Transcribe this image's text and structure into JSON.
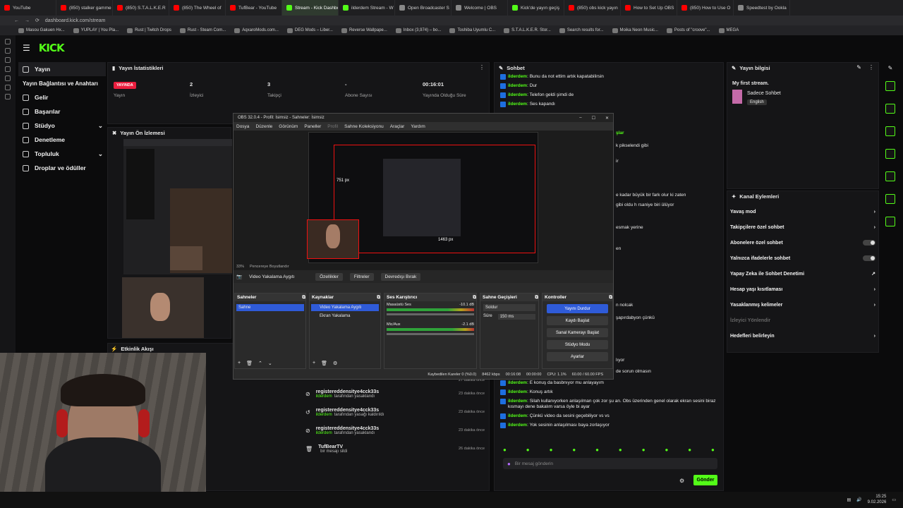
{
  "browser": {
    "tabs": [
      {
        "label": "YouTube",
        "color": "#ff0000",
        "active": false
      },
      {
        "label": "(850) stalker gamme",
        "color": "#ff0000",
        "active": false
      },
      {
        "label": "(850) S.T.A.L.K.E.R",
        "color": "#ff0000",
        "active": false
      },
      {
        "label": "(850) The Wheel of",
        "color": "#ff0000",
        "active": false
      },
      {
        "label": "TufBear - YouTube",
        "color": "#ff0000",
        "active": false
      },
      {
        "label": "Stream - Kick Dashbo",
        "color": "#53fc18",
        "active": true
      },
      {
        "label": "ilderdem Stream - W",
        "color": "#53fc18",
        "active": false
      },
      {
        "label": "Open Broadcaster S",
        "color": "#888888",
        "active": false
      },
      {
        "label": "Welcome | OBS",
        "color": "#888888",
        "active": false
      },
      {
        "label": "Kick'de yayın geçiş",
        "color": "#53fc18",
        "active": false
      },
      {
        "label": "(850) obs kick yayın",
        "color": "#ff0000",
        "active": false
      },
      {
        "label": "How to Set Up OBS",
        "color": "#ff0000",
        "active": false
      },
      {
        "label": "(850) How to Use O",
        "color": "#ff0000",
        "active": false
      },
      {
        "label": "Speedtest by Ookla",
        "color": "#888888",
        "active": false
      }
    ],
    "url": "dashboard.kick.com/stream",
    "bookmarks": [
      "Masou Gakuen Hx...",
      "YUPLAY | You Pla...",
      "Rust | Twitch Drops",
      "Rust - Steam Com...",
      "AqxaroMods.com...",
      "DEG Mods – Liber...",
      "Reverse Wallpape...",
      "Inbox (3,974) – bo...",
      "Toshiba Uyumlu C...",
      "S.T.A.L.K.E.R. Stor...",
      "Search results for...",
      "Moika Neon Music...",
      "Posts of \"croove\"...",
      "MEGA"
    ]
  },
  "sidebar": {
    "logo": "KICK",
    "items": [
      {
        "label": "Yayın",
        "selected": true
      },
      {
        "label": "Yayın Bağlantısı ve Anahtarı",
        "selected": false
      },
      {
        "label": "Gelir",
        "selected": false
      },
      {
        "label": "Başarılar",
        "selected": false
      },
      {
        "label": "Stüdyo",
        "selected": false,
        "chevron": true
      },
      {
        "label": "Denetleme",
        "selected": false
      },
      {
        "label": "Topluluk",
        "selected": false,
        "chevron": true
      },
      {
        "label": "Droplar ve ödüller",
        "selected": false
      }
    ]
  },
  "stats": {
    "title": "Yayın İstatistikleri",
    "live_badge": "YAYINDA",
    "live_label": "Yayın",
    "viewers_value": "2",
    "viewers_label": "İzleyici",
    "followers_value": "3",
    "followers_label": "Takipçi",
    "subs_value": "-",
    "subs_label": "Abone Sayısı",
    "duration_value": "00:16:01",
    "duration_label": "Yayında Olduğu Süre"
  },
  "preview": {
    "title": "Yayın Ön İzlemesi"
  },
  "activity": {
    "title": "Etkinlik Akışı",
    "items": [
      {
        "time": "27 dakika önce",
        "user": "",
        "user_line": "",
        "detail": "",
        "icon": "",
        "partial": true
      },
      {
        "time": "23 dakika önce",
        "user": "registereddensitye4cck33s",
        "user_line": "ilderdem",
        "detail": "tarafından yasaklandı",
        "icon": "ban-icon"
      },
      {
        "time": "23 dakika önce",
        "user": "registereddensitye4cck33s",
        "user_line": "ilderdem",
        "detail": "tarafından yasağı kaldırıldı",
        "icon": "undo-icon"
      },
      {
        "time": "23 dakika önce",
        "user": "registereddensitye4cck33s",
        "user_line": "ilderdem",
        "detail": "tarafından yasaklandı",
        "icon": "ban-icon"
      },
      {
        "time": "26 dakika önce",
        "user": "TufBearTV",
        "user_line": "",
        "detail": "bir mesajı sildi",
        "icon": "trash-icon"
      }
    ]
  },
  "obs": {
    "title": "OBS 32.0.4 - Profil: İsimsiz - Sahneler: İsimsiz",
    "menu": [
      "Dosya",
      "Düzenle",
      "Görünüm",
      "Paneller",
      "Profil",
      "Sahne Koleksiyonu",
      "Araçlar",
      "Yardım"
    ],
    "zoom": "33%",
    "fit_label": "Pencereye Boyutlandır",
    "source_name": "Video Yakalama Aygıtı",
    "props_btn": "Özellikler",
    "filters_btn": "Filtreler",
    "deactivate_btn": "Devredışı Bırak",
    "scenes_title": "Sahneler",
    "scene_item": "Sahne",
    "sources_title": "Kaynaklar",
    "source_items": [
      "Video Yakalama Aygıtı",
      "Ekran Yakalama"
    ],
    "mixer_title": "Ses Karıştırıcı",
    "mixer_channels": [
      {
        "name": "Masaüstü Ses",
        "db": "-10.1 dB"
      },
      {
        "name": "Mic/Aux",
        "db": "-2.1 dB"
      }
    ],
    "transitions_title": "Sahne Geçişleri",
    "transition_value": "Soldur",
    "duration_label": "Süre",
    "duration_value": "150 ms",
    "controls_title": "Kontroller",
    "controls": [
      "Yayını Durdur",
      "Kaydı Başlat",
      "Sanal Kamerayı Başlat",
      "Stüdyo Modu",
      "Ayarlar"
    ],
    "status": {
      "dropped": "Kaybedilen Kareler 0 (%0.0)",
      "bitrate": "8462 kbps",
      "stream_time": "00:16:08",
      "rec_time": "00:00:00",
      "cpu": "CPU: 1.1%",
      "fps": "60.00 / 60.00 FPS"
    },
    "canvas_labels": [
      "751 px",
      "1463 px"
    ]
  },
  "chat": {
    "title": "Sohbet",
    "top_messages": [
      {
        "user": "ilderdem",
        "text": "Bunu da not ettim artık kapatabilirsin"
      },
      {
        "user": "ilderdem",
        "text": "Dur"
      },
      {
        "user": "ilderdem",
        "text": "Telefon geldi şimdi de"
      },
      {
        "user": "ilderdem",
        "text": "Ses kapandı"
      }
    ],
    "partial_lines": [
      "şlar",
      "k pikselendi gibi",
      "ir",
      "e kadar büyük bir fark olur ki zaten",
      "gibi oldu h rsaniye biri ülüyor",
      "esmak yerine",
      "en",
      "n nolcak",
      "şapırdabyon çünkü",
      "lıyor",
      "de sorun olmasın"
    ],
    "bottom_messages": [
      {
        "user": "ilderdem",
        "text": "E konuş da basbnıyor mu anlayayım"
      },
      {
        "user": "ilderdem",
        "text": "Konuş artık"
      },
      {
        "user": "ilderdem",
        "text": "Silah kullanıyorken anlaşılman çok zor şu an. Obs üzerinden genel olarak ekran sesini biraz kısmayı dene bakalım varsa öyle bi ayar"
      },
      {
        "user": "ilderdem",
        "text": "Çünkü video da sesini geçebiliyor vs vs"
      },
      {
        "user": "ilderdem",
        "text": "Yok sesinin anlaşılması baya zorlaşıyor"
      }
    ],
    "input_placeholder": "Bir mesaj gönderin",
    "send_label": "Gönder"
  },
  "stream_info": {
    "title": "Yayın bilgisi",
    "stream_title": "My first stream.",
    "category": "Sadece Sohbet",
    "language": "English"
  },
  "channel_actions": {
    "title": "Kanal Eylemleri",
    "items": [
      {
        "label": "Yavaş mod",
        "control": "chevron"
      },
      {
        "label": "Takipçilere özel sohbet",
        "control": "chevron"
      },
      {
        "label": "Abonelere özel sohbet",
        "control": "toggle"
      },
      {
        "label": "Yalnızca ifadelerle sohbet",
        "control": "toggle"
      },
      {
        "label": "Yapay Zeka ile Sohbet Denetimi",
        "control": "external"
      },
      {
        "label": "Hesap yaşı kısıtlaması",
        "control": "chevron"
      },
      {
        "label": "Yasaklanmış kelimeler",
        "control": "chevron"
      },
      {
        "label": "İzleyici Yönlendir",
        "control": "none"
      },
      {
        "label": "Hedefleri belirleyin",
        "control": "chevron"
      }
    ]
  },
  "taskbar": {
    "time": "15:25",
    "date": "9.02.2026"
  },
  "colors": {
    "accent": "#53fc18",
    "live": "#ea1e3e",
    "obs_active": "#2f5bd8"
  }
}
